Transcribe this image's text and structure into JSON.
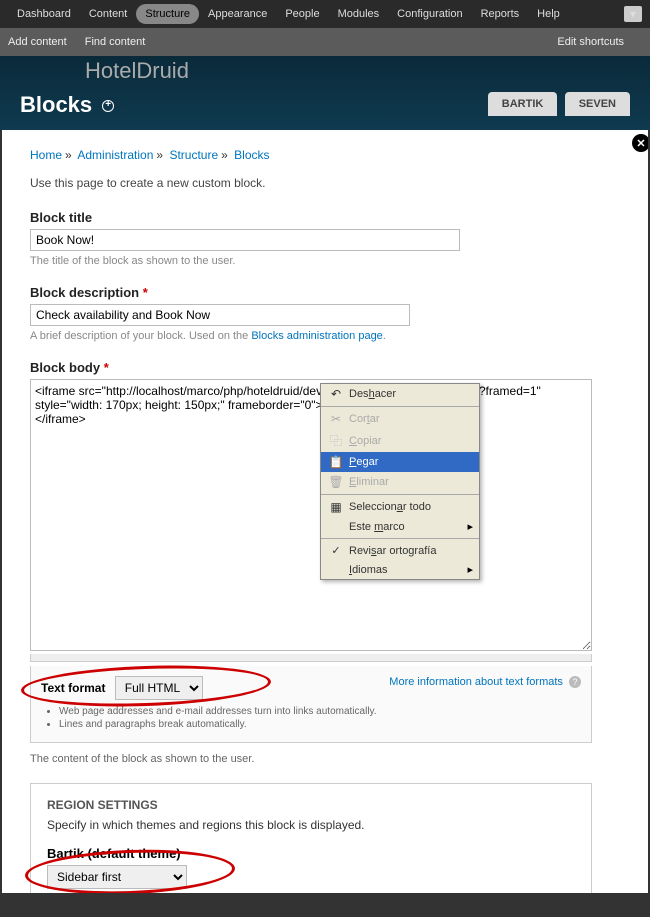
{
  "topmenu": {
    "items": [
      "Dashboard",
      "Content",
      "Structure",
      "Appearance",
      "People",
      "Modules",
      "Configuration",
      "Reports",
      "Help"
    ],
    "active_index": 2
  },
  "shortcuts": {
    "add_content": "Add content",
    "find_content": "Find content",
    "edit": "Edit shortcuts"
  },
  "site_name": "HotelDruid",
  "overlay_title": "Blocks",
  "tabs": {
    "bartik": "BARTIK",
    "seven": "SEVEN"
  },
  "breadcrumb": {
    "home": "Home",
    "admin": "Administration",
    "structure": "Structure",
    "blocks": "Blocks"
  },
  "intro": "Use this page to create a new custom block.",
  "block_title": {
    "label": "Block title",
    "value": "Book Now!",
    "desc": "The title of the block as shown to the user."
  },
  "block_description": {
    "label": "Block description",
    "value": "Check availability and Book Now",
    "desc_prefix": "A brief description of your block. Used on the ",
    "desc_link": "Blocks administration page",
    "desc_suffix": "."
  },
  "block_body": {
    "label": "Block body",
    "value": "<iframe src=\"http://localhost/marco/php/hoteldruid/dev/mod/instant_booking_tpl.php?framed=1\" style=\"width: 170px; height: 150px;\" frameborder=\"0\">\n</iframe>"
  },
  "text_format": {
    "label": "Text format",
    "value": "Full HTML",
    "more_info": "More information about text formats",
    "tips": [
      "Web page addresses and e-mail addresses turn into links automatically.",
      "Lines and paragraphs break automatically."
    ]
  },
  "below_format": "The content of the block as shown to the user.",
  "region": {
    "title": "REGION SETTINGS",
    "desc": "Specify in which themes and regions this block is displayed.",
    "theme_label": "Bartik (default theme)",
    "value": "Sidebar first"
  },
  "context_menu": {
    "undo": "Deshacer",
    "cut": "Cortar",
    "copy": "Copiar",
    "paste": "Pegar",
    "delete": "Eliminar",
    "select_all": "Seleccionar todo",
    "this_frame": "Este marco",
    "spellcheck": "Revisar ortografía",
    "languages": "Idiomas"
  }
}
